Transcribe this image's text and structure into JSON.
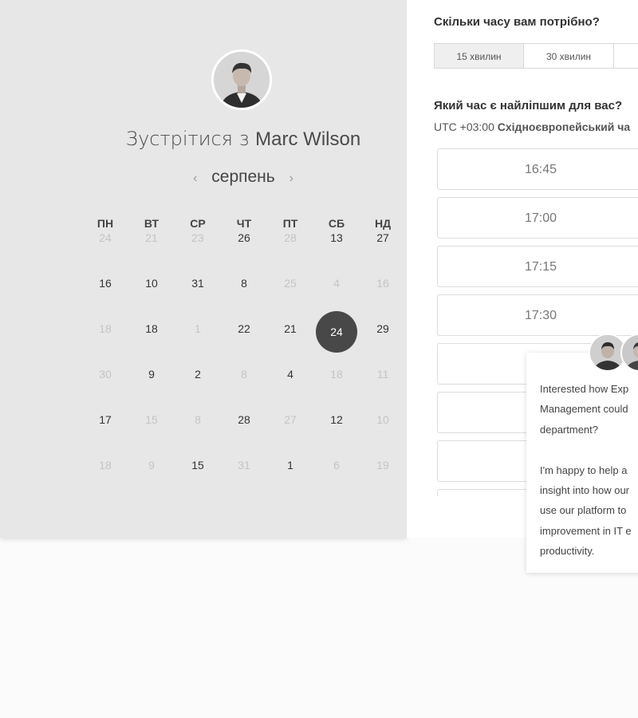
{
  "scheduler": {
    "title_prefix": "Зустрітися з",
    "host_name": "Marc Wilson",
    "month": "серпень",
    "prev_icon": "‹",
    "next_icon": "›",
    "weekdays": [
      "ПН",
      "ВТ",
      "СР",
      "ЧТ",
      "ПТ",
      "СБ",
      "НД"
    ],
    "weeks": [
      [
        {
          "d": "24",
          "s": "inactive"
        },
        {
          "d": "21",
          "s": "inactive"
        },
        {
          "d": "23",
          "s": "inactive"
        },
        {
          "d": "26",
          "s": "active"
        },
        {
          "d": "28",
          "s": "inactive"
        },
        {
          "d": "13",
          "s": "active"
        },
        {
          "d": "27",
          "s": "active"
        }
      ],
      [
        {
          "d": "16",
          "s": "active"
        },
        {
          "d": "10",
          "s": "active"
        },
        {
          "d": "31",
          "s": "active"
        },
        {
          "d": "8",
          "s": "active"
        },
        {
          "d": "25",
          "s": "inactive"
        },
        {
          "d": "4",
          "s": "inactive"
        },
        {
          "d": "16",
          "s": "inactive"
        }
      ],
      [
        {
          "d": "18",
          "s": "inactive"
        },
        {
          "d": "18",
          "s": "active"
        },
        {
          "d": "1",
          "s": "inactive"
        },
        {
          "d": "22",
          "s": "active"
        },
        {
          "d": "21",
          "s": "active"
        },
        {
          "d": "24",
          "s": "selected"
        },
        {
          "d": "29",
          "s": "active"
        }
      ],
      [
        {
          "d": "30",
          "s": "inactive"
        },
        {
          "d": "9",
          "s": "active"
        },
        {
          "d": "2",
          "s": "active"
        },
        {
          "d": "8",
          "s": "inactive"
        },
        {
          "d": "4",
          "s": "active"
        },
        {
          "d": "18",
          "s": "inactive"
        },
        {
          "d": "11",
          "s": "inactive"
        }
      ],
      [
        {
          "d": "17",
          "s": "active"
        },
        {
          "d": "15",
          "s": "inactive"
        },
        {
          "d": "8",
          "s": "inactive"
        },
        {
          "d": "28",
          "s": "active"
        },
        {
          "d": "27",
          "s": "inactive"
        },
        {
          "d": "12",
          "s": "active"
        },
        {
          "d": "10",
          "s": "inactive"
        }
      ],
      [
        {
          "d": "18",
          "s": "inactive"
        },
        {
          "d": "9",
          "s": "inactive"
        },
        {
          "d": "15",
          "s": "active"
        },
        {
          "d": "31",
          "s": "inactive"
        },
        {
          "d": "1",
          "s": "active"
        },
        {
          "d": "6",
          "s": "inactive"
        },
        {
          "d": "19",
          "s": "inactive"
        }
      ]
    ]
  },
  "booking": {
    "duration_question": "Скільки часу вам потрібно?",
    "durations": [
      {
        "label": "15 хвилин",
        "active": true
      },
      {
        "label": "30 хвилин",
        "active": false
      },
      {
        "label": "",
        "active": false
      }
    ],
    "time_question": "Який час є найліпшим для вас?",
    "timezone_offset": "UTC +03:00",
    "timezone_name": "Східноєвропейський ча",
    "slots": [
      "16:45",
      "17:00",
      "17:15",
      "17:30",
      "",
      "",
      "",
      ""
    ]
  },
  "chat": {
    "message": "Interested how Exp\nManagement could\ndepartment?\n\nI'm happy to help a\ninsight into how our\nuse our platform to\nimprovement in IT e\nproductivity."
  }
}
